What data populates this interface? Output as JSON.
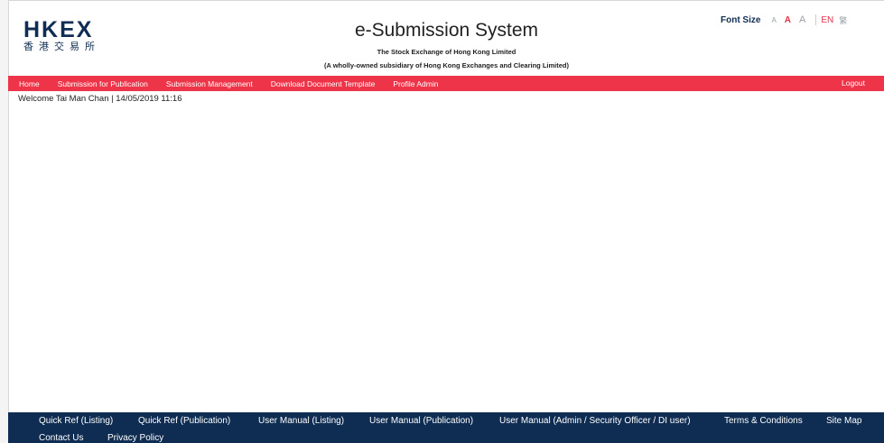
{
  "header": {
    "logo_text": "HKEX",
    "logo_subtext": "香港交易所",
    "title": "e-Submission System",
    "subtitle_line1": "The Stock Exchange of Hong Kong Limited",
    "subtitle_line2": "(A wholly-owned subsidiary of Hong Kong Exchanges and Clearing Limited)"
  },
  "utility": {
    "font_size_label": "Font Size",
    "font_small": "A",
    "font_medium": "A",
    "font_large": "A",
    "lang_en": "EN",
    "lang_tc": "繁"
  },
  "nav": {
    "items": [
      "Home",
      "Submission for Publication",
      "Submission Management",
      "Download Document Template",
      "Profile Admin"
    ],
    "logout": "Logout"
  },
  "welcome": "Welcome Tai Man Chan | 14/05/2019 11:16",
  "footer": {
    "links": [
      "Quick Ref (Listing)",
      "Quick Ref (Publication)",
      "User Manual (Listing)",
      "User Manual (Publication)",
      "User Manual (Admin / Security Officer / DI user)",
      "Terms & Conditions",
      "Site Map",
      "Contact Us",
      "Privacy Policy"
    ]
  },
  "colors": {
    "brand_navy": "#0f2d52",
    "nav_red": "#ee3448",
    "accent_red": "#e3324a"
  }
}
